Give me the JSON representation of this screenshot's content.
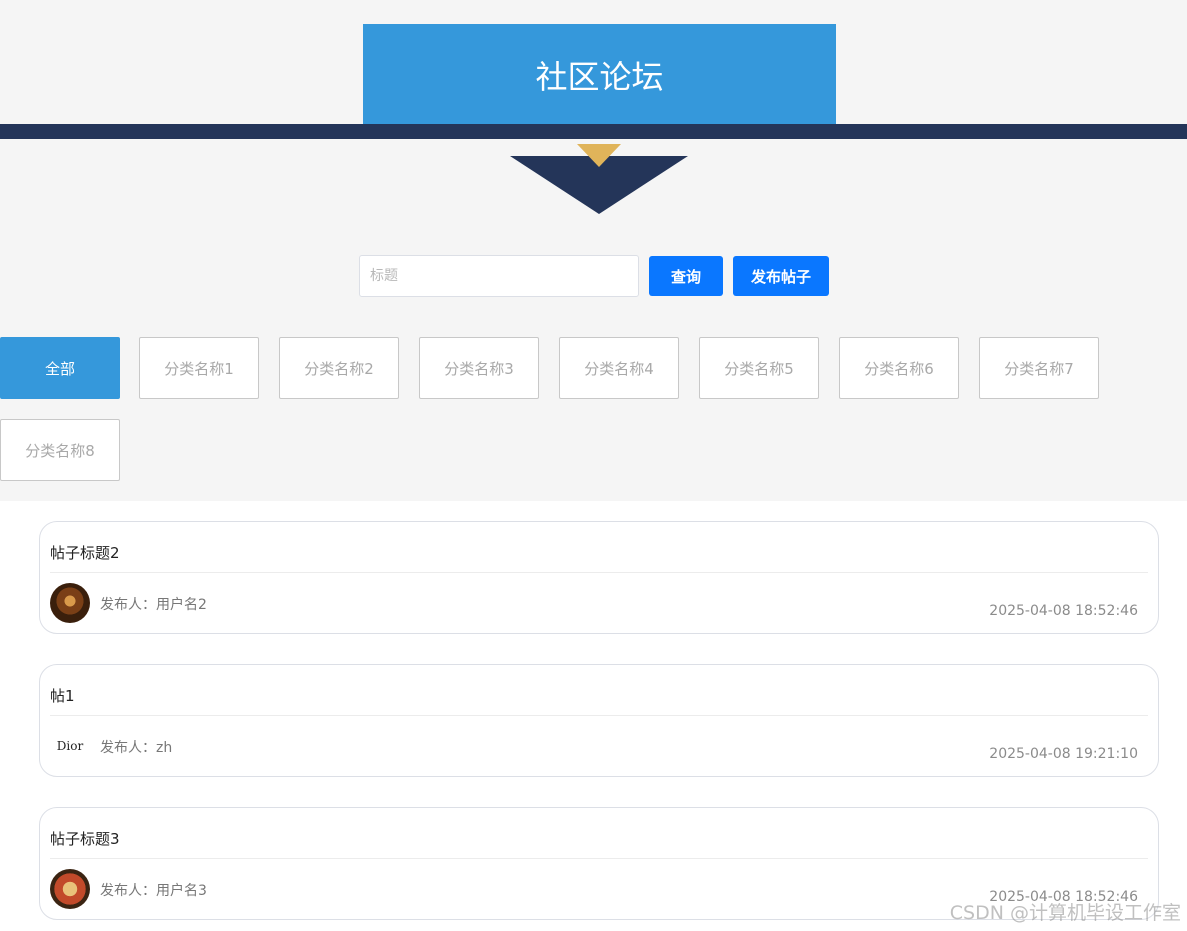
{
  "header": {
    "title": "社区论坛"
  },
  "search": {
    "placeholder": "标题",
    "query_label": "查询",
    "publish_label": "发布帖子"
  },
  "categories": [
    "全部",
    "分类名称1",
    "分类名称2",
    "分类名称3",
    "分类名称4",
    "分类名称5",
    "分类名称6",
    "分类名称7",
    "分类名称8"
  ],
  "posts": [
    {
      "title": "帖子标题2",
      "author": "发布人：用户名2",
      "time": "2025-04-08 18:52:46",
      "avatar": "interior-photo-avatar"
    },
    {
      "title": "帖1",
      "author": "发布人：zh",
      "time": "2025-04-08 19:21:10",
      "avatar_text": "Dior"
    },
    {
      "title": "帖子标题3",
      "author": "发布人：用户名3",
      "time": "2025-04-08 18:52:46",
      "avatar": "pizza-photo-avatar"
    }
  ],
  "watermark": "CSDN @计算机毕设工作室",
  "colors": {
    "title_bg": "#3598db",
    "bar": "#243559",
    "accent_triangle": "#e0b45a",
    "button": "#0a77ff"
  }
}
